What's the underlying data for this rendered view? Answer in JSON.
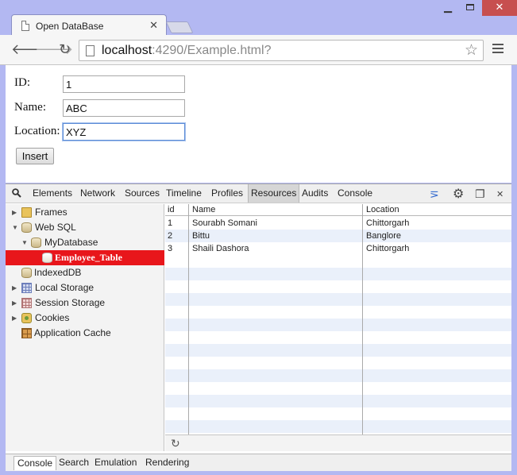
{
  "window": {
    "tab_title": "Open DataBase",
    "tab_close": "✕",
    "min_label": "▁",
    "close_label": "✕"
  },
  "toolbar": {
    "url_host": "localhost",
    "url_rest": ":4290/Example.html?"
  },
  "form": {
    "id_label": "ID:",
    "id_value": "1",
    "name_label": "Name:",
    "name_value": "ABC",
    "location_label": "Location:",
    "location_value": "XYZ",
    "insert_label": "Insert"
  },
  "devtools": {
    "tabs": [
      "Elements",
      "Network",
      "Sources",
      "Timeline",
      "Profiles",
      "Resources",
      "Audits",
      "Console"
    ],
    "active_tab": "Resources",
    "tree": {
      "frames": "Frames",
      "web_sql": "Web SQL",
      "database": "MyDatabase",
      "table": "Employee_Table",
      "indexeddb": "IndexedDB",
      "local_storage": "Local Storage",
      "session_storage": "Session Storage",
      "cookies": "Cookies",
      "app_cache": "Application Cache"
    },
    "grid": {
      "columns": [
        "id",
        "Name",
        "Location"
      ],
      "rows": [
        [
          "1",
          "Sourabh Somani",
          "Chittorgarh"
        ],
        [
          "2",
          "Bittu",
          "Banglore"
        ],
        [
          "3",
          "Shaili Dashora",
          "Chittorgarh"
        ]
      ]
    },
    "drawer_tabs": [
      "Console",
      "Search",
      "Emulation",
      "Rendering"
    ],
    "active_drawer_tab": "Console"
  },
  "icons": {
    "back": "back-arrow-icon",
    "forward": "forward-arrow-icon",
    "reload": "reload-icon",
    "star": "star-icon",
    "menu": "hamburger-menu-icon",
    "settings": "gear-icon",
    "refresh": "refresh-icon"
  },
  "colors": {
    "frame": "#b3b8f2",
    "selected_tree_item": "#e8161b",
    "window_close": "#c74f4f"
  }
}
